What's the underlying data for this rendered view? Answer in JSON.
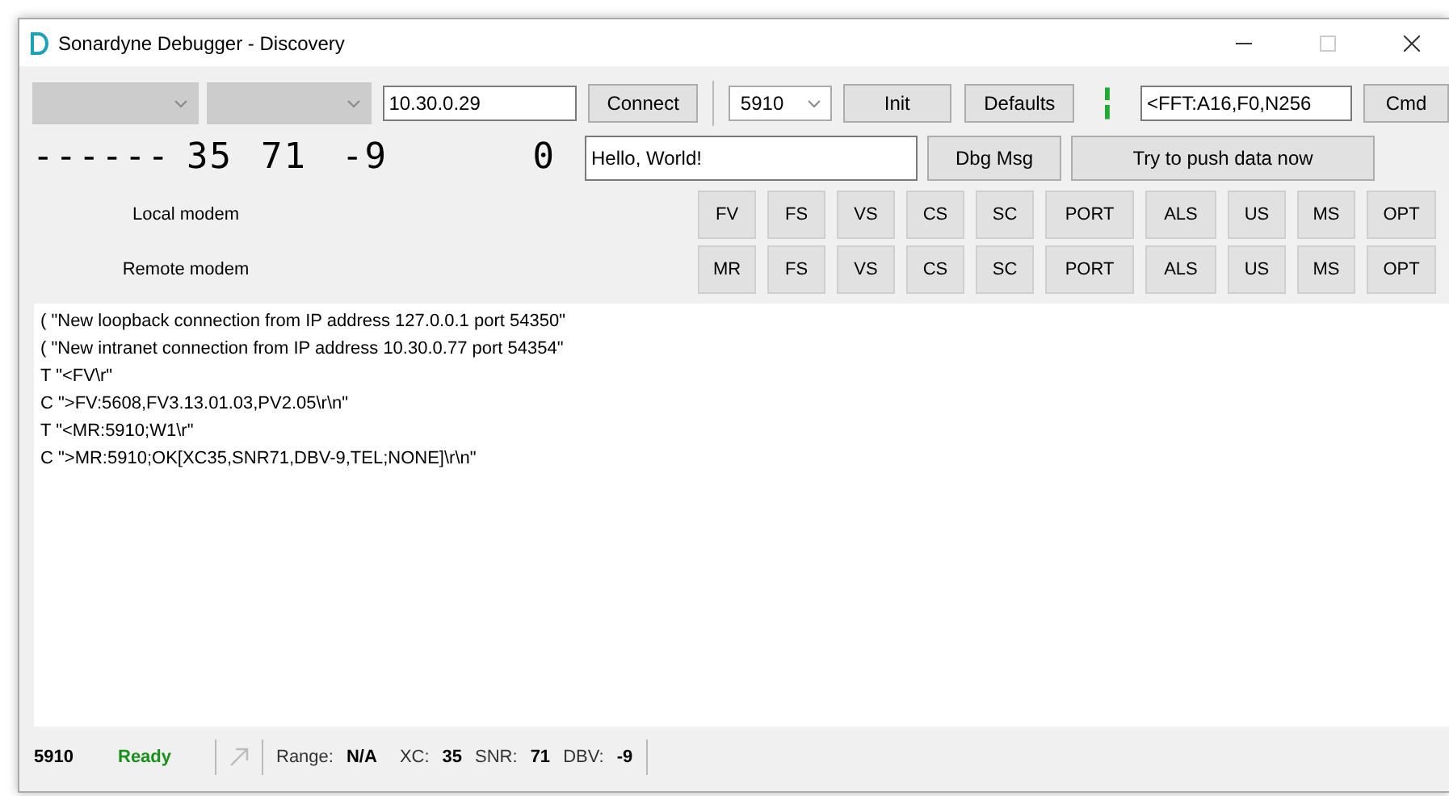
{
  "window": {
    "title": "Sonardyne Debugger - Discovery",
    "maximize_disabled": true
  },
  "toolbar": {
    "combo_1": {
      "disabled": true
    },
    "combo_2": {
      "disabled": true
    },
    "address": "10.30.0.29",
    "connect": "Connect",
    "port": "5910",
    "init": "Init",
    "defaults": "Defaults",
    "command": "<FFT:A16,F0,N256",
    "cmd": "Cmd"
  },
  "display": {
    "readouts": [
      "------",
      "35",
      "71",
      "-9",
      "0"
    ],
    "message": "Hello, World!",
    "dbg_msg": "Dbg Msg",
    "push": "Try to push data now"
  },
  "modems": [
    {
      "label": "Local modem",
      "buttons": [
        "FV",
        "FS",
        "VS",
        "CS",
        "SC",
        "PORT",
        "ALS",
        "US",
        "MS",
        "OPT"
      ]
    },
    {
      "label": "Remote modem",
      "buttons": [
        "MR",
        "FS",
        "VS",
        "CS",
        "SC",
        "PORT",
        "ALS",
        "US",
        "MS",
        "OPT"
      ]
    }
  ],
  "log": [
    "( \"New loopback connection from IP address 127.0.0.1 port 54350\"",
    "( \"New intranet connection from IP address 10.30.0.77 port 54354\"",
    "T \"<FV\\r\"",
    "C \">FV:5608,FV3.13.01.03,PV2.05\\r\\n\"",
    "T \"<MR:5910;W1\\r\"",
    "C \">MR:5910;OK[XC35,SNR71,DBV-9,TEL;NONE]\\r\\n\""
  ],
  "status_bar": {
    "id": "5910",
    "status": "Ready",
    "ready": true,
    "arrow_disabled": true,
    "fields": [
      {
        "label": "Range:",
        "value": "N/A"
      },
      {
        "label": "XC:",
        "value": "35"
      },
      {
        "label": "SNR:",
        "value": "71"
      },
      {
        "label": "DBV:",
        "value": "-9"
      }
    ]
  }
}
